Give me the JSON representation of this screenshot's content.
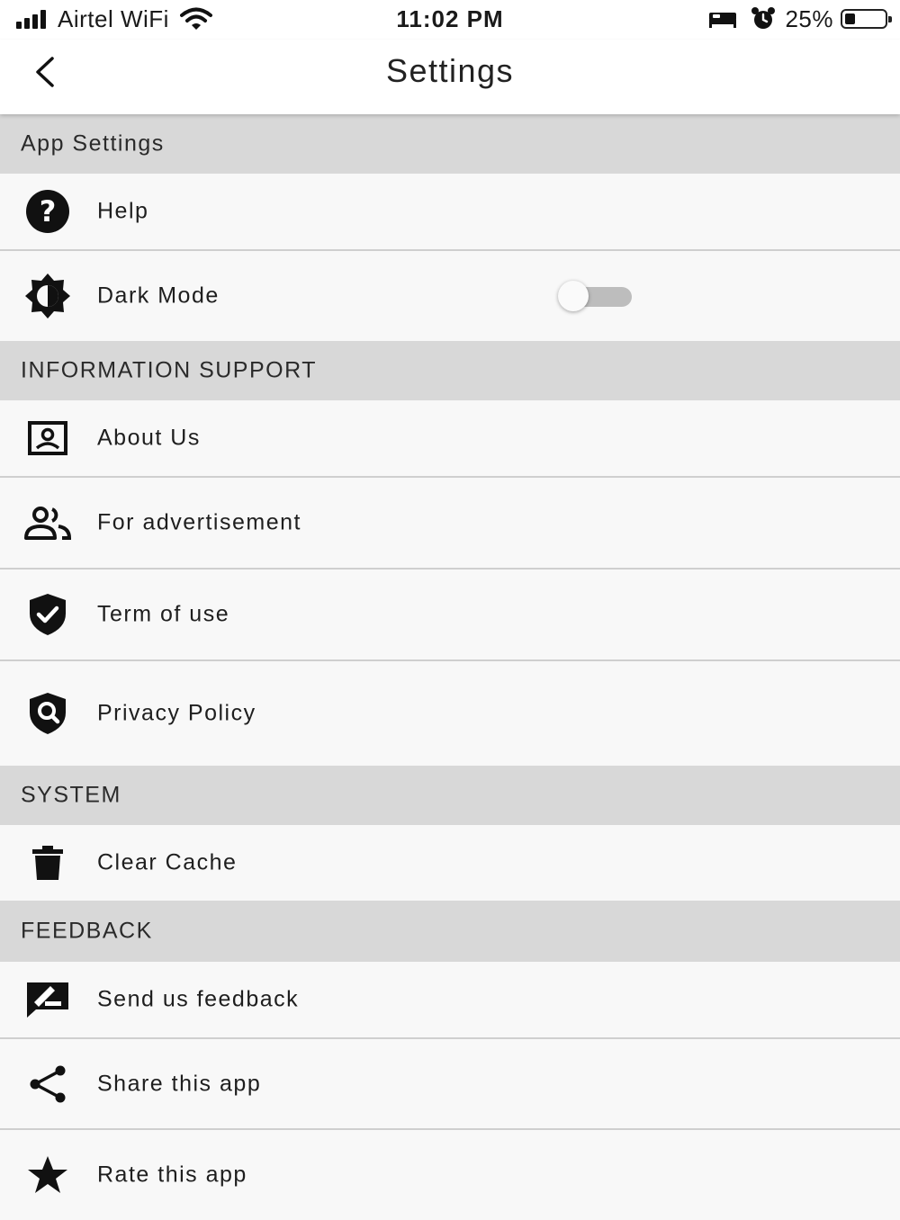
{
  "status_bar": {
    "carrier": "Airtel WiFi",
    "time": "11:02 PM",
    "battery": "25%",
    "battery_level": 0.25
  },
  "header": {
    "title": "Settings",
    "back_icon": "chevron-left-icon"
  },
  "sections": {
    "app": {
      "title": "App Settings",
      "help": {
        "label": "Help",
        "icon": "help-circle-icon"
      },
      "dark_mode": {
        "label": "Dark Mode",
        "icon": "brightness-icon",
        "enabled": false
      }
    },
    "info": {
      "title": "INFORMATION SUPPORT",
      "about": {
        "label": "About Us",
        "icon": "contact-card-icon"
      },
      "ads": {
        "label": "For advertisement",
        "icon": "people-icon"
      },
      "terms": {
        "label": "Term of use",
        "icon": "shield-check-icon"
      },
      "privacy": {
        "label": "Privacy Policy",
        "icon": "shield-search-icon"
      }
    },
    "system": {
      "title": "SYSTEM",
      "cache": {
        "label": "Clear Cache",
        "icon": "trash-icon"
      }
    },
    "feedback": {
      "title": "FEEDBACK",
      "send": {
        "label": "Send us feedback",
        "icon": "feedback-icon"
      },
      "share": {
        "label": "Share this app",
        "icon": "share-icon"
      },
      "rate": {
        "label": "Rate this app",
        "icon": "star-icon"
      }
    }
  }
}
